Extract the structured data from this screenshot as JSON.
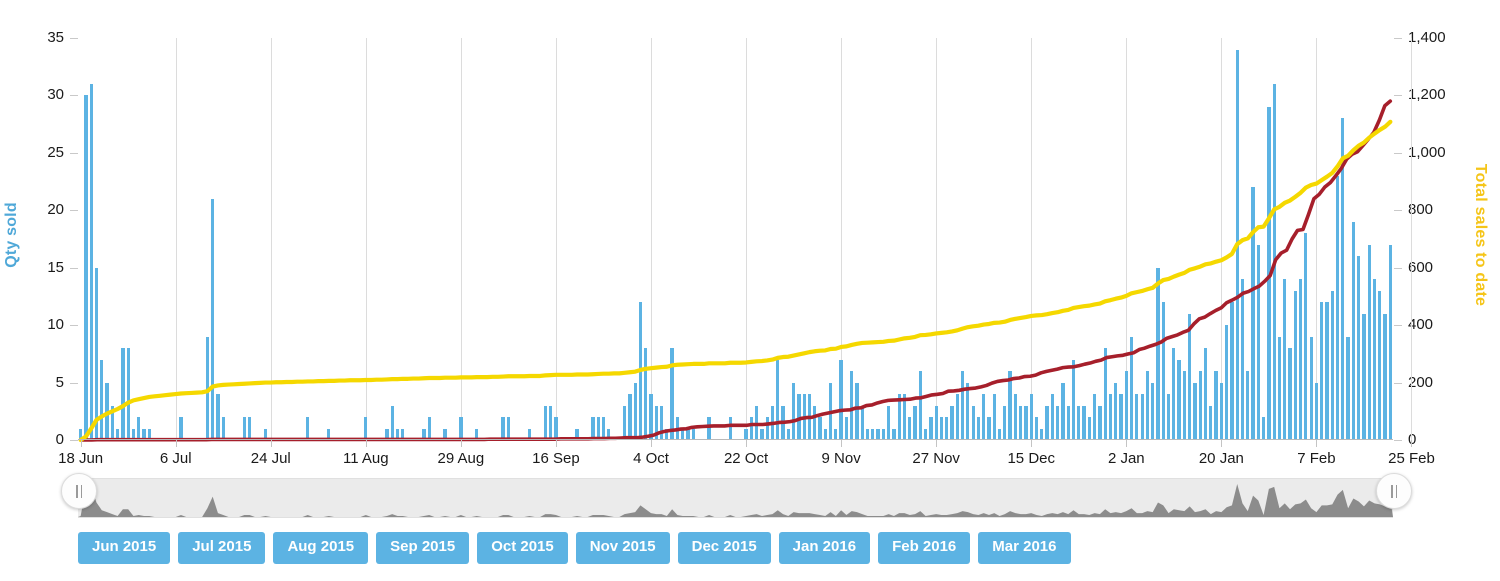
{
  "chart_data": {
    "type": "bar",
    "title": "",
    "xlabel": "",
    "ylabel": "Qty sold",
    "y2label": "Total sales to date",
    "ylim": [
      0,
      35
    ],
    "y2lim": [
      0,
      1400
    ],
    "grid": true,
    "legend_position": "none",
    "y_ticks": [
      "0",
      "5",
      "10",
      "15",
      "20",
      "25",
      "30",
      "35"
    ],
    "y2_ticks": [
      "0",
      "200",
      "400",
      "600",
      "800",
      "1,000",
      "1,200",
      "1,400"
    ],
    "x_tick_labels": [
      "18 Jun",
      "6 Jul",
      "24 Jul",
      "11 Aug",
      "29 Aug",
      "16 Sep",
      "4 Oct",
      "22 Oct",
      "9 Nov",
      "27 Nov",
      "15 Dec",
      "2 Jan",
      "20 Jan",
      "7 Feb",
      "25 Feb"
    ],
    "x_tick_indices": [
      0,
      18,
      36,
      54,
      72,
      90,
      108,
      126,
      144,
      162,
      180,
      198,
      216,
      234,
      252
    ],
    "colors": {
      "bar": "#5cb3e3",
      "qty_axis": "#4fa8d8",
      "total_sales_line": "#f5d800",
      "total_sales_axis": "#f5c518",
      "cumulative_line": "#a61f2b",
      "gridline": "#dcdcdc",
      "navigator_bg": "#ebebeb",
      "navigator_series": "#8c8c8c",
      "button": "#5cb3e3",
      "button_text": "#ffffff"
    },
    "series": [
      {
        "name": "Qty sold",
        "type": "bar",
        "axis": "left",
        "values": [
          1,
          30,
          31,
          15,
          7,
          5,
          3,
          1,
          8,
          8,
          1,
          2,
          1,
          1,
          0,
          0,
          0,
          0,
          0,
          2,
          0,
          0,
          0,
          0,
          9,
          21,
          4,
          2,
          0,
          0,
          0,
          2,
          2,
          0,
          0,
          1,
          0,
          0,
          0,
          0,
          0,
          0,
          0,
          2,
          0,
          0,
          0,
          1,
          0,
          0,
          0,
          0,
          0,
          0,
          2,
          0,
          0,
          0,
          1,
          3,
          1,
          1,
          0,
          0,
          0,
          1,
          2,
          0,
          0,
          1,
          0,
          0,
          2,
          0,
          0,
          1,
          0,
          0,
          0,
          0,
          2,
          2,
          0,
          0,
          0,
          1,
          0,
          0,
          3,
          3,
          2,
          0,
          0,
          0,
          1,
          0,
          0,
          2,
          2,
          2,
          1,
          0,
          0,
          3,
          4,
          5,
          12,
          8,
          4,
          3,
          3,
          1,
          8,
          2,
          1,
          1,
          1,
          0,
          0,
          2,
          0,
          0,
          0,
          2,
          0,
          0,
          1,
          2,
          3,
          1,
          2,
          3,
          7,
          3,
          1,
          5,
          4,
          4,
          4,
          3,
          2,
          1,
          5,
          1,
          7,
          2,
          6,
          5,
          3,
          1,
          1,
          1,
          1,
          3,
          1,
          4,
          4,
          2,
          3,
          6,
          1,
          2,
          3,
          2,
          2,
          3,
          4,
          6,
          5,
          3,
          2,
          4,
          2,
          4,
          1,
          3,
          6,
          4,
          3,
          3,
          4,
          2,
          1,
          3,
          4,
          3,
          5,
          3,
          7,
          3,
          3,
          2,
          4,
          3,
          8,
          4,
          5,
          4,
          6,
          9,
          4,
          4,
          6,
          5,
          15,
          12,
          4,
          8,
          7,
          6,
          11,
          5,
          6,
          8,
          3,
          6,
          5,
          10,
          12,
          34,
          14,
          6,
          22,
          17,
          2,
          29,
          31,
          9,
          14,
          8,
          13,
          14,
          18,
          9,
          5,
          12,
          12,
          13,
          23,
          28,
          9,
          19,
          16,
          11,
          17,
          14,
          13,
          11,
          17
        ],
        "max_value": 34,
        "notable_peaks": [
          {
            "x_label": "18 Jun",
            "value": 31
          },
          {
            "x_label": "mid Jul",
            "value": 21
          },
          {
            "x_label": "early Oct",
            "value": 12
          },
          {
            "x_label": "late Jan",
            "value": 34
          },
          {
            "x_label": "early Feb",
            "value": 31
          }
        ]
      },
      {
        "name": "Total sales to date",
        "type": "line",
        "axis": "right",
        "values": [
          0,
          12,
          40,
          70,
          82,
          92,
          100,
          108,
          118,
          130,
          138,
          142,
          146,
          150,
          152,
          154,
          156,
          158,
          160,
          162,
          163,
          164,
          165,
          166,
          170,
          186,
          190,
          192,
          193,
          194,
          195,
          196,
          197,
          198,
          199,
          200,
          200,
          201,
          201,
          202,
          202,
          203,
          203,
          204,
          204,
          205,
          205,
          206,
          206,
          207,
          207,
          208,
          208,
          208,
          209,
          209,
          210,
          210,
          211,
          212,
          212,
          213,
          213,
          214,
          214,
          215,
          216,
          216,
          216,
          217,
          217,
          217,
          218,
          218,
          218,
          219,
          219,
          219,
          220,
          220,
          221,
          222,
          222,
          222,
          222,
          223,
          223,
          223,
          225,
          226,
          227,
          227,
          227,
          227,
          228,
          228,
          228,
          229,
          230,
          231,
          231,
          232,
          232,
          234,
          236,
          238,
          244,
          248,
          250,
          252,
          254,
          255,
          260,
          262,
          263,
          264,
          265,
          265,
          265,
          267,
          267,
          267,
          267,
          269,
          269,
          269,
          270,
          272,
          274,
          275,
          277,
          280,
          286,
          289,
          290,
          294,
          298,
          302,
          306,
          309,
          311,
          312,
          317,
          318,
          324,
          326,
          331,
          335,
          338,
          339,
          340,
          341,
          342,
          345,
          346,
          350,
          354,
          356,
          359,
          365,
          366,
          368,
          371,
          373,
          375,
          378,
          382,
          388,
          393,
          396,
          398,
          402,
          404,
          408,
          409,
          412,
          418,
          422,
          425,
          428,
          432,
          434,
          435,
          438,
          442,
          445,
          450,
          453,
          460,
          463,
          466,
          468,
          472,
          475,
          483,
          487,
          492,
          496,
          502,
          511,
          515,
          519,
          525,
          530,
          545,
          557,
          561,
          569,
          576,
          582,
          593,
          598,
          604,
          612,
          615,
          621,
          626,
          636,
          648,
          682,
          696,
          702,
          724,
          741,
          743,
          772,
          803,
          812,
          826,
          834,
          847,
          861,
          879,
          888,
          893,
          905,
          917,
          930,
          953,
          981,
          990,
          1009,
          1025,
          1036,
          1053,
          1067,
          1080,
          1091,
          1108
        ],
        "end_value": 1225
      },
      {
        "name": "Cumulative",
        "type": "line",
        "axis": "right",
        "values": [
          0,
          0,
          0,
          1,
          1,
          1,
          1,
          1,
          1,
          1,
          1,
          1,
          1,
          1,
          1,
          1,
          1,
          1,
          1,
          1,
          1,
          1,
          1,
          1,
          2,
          2,
          2,
          2,
          2,
          2,
          2,
          2,
          2,
          2,
          2,
          2,
          2,
          2,
          2,
          2,
          2,
          2,
          2,
          2,
          2,
          2,
          2,
          2,
          2,
          2,
          2,
          2,
          2,
          2,
          2,
          2,
          2,
          2,
          2,
          2,
          2,
          2,
          2,
          2,
          2,
          2,
          2,
          2,
          2,
          2,
          2,
          2,
          2,
          2,
          2,
          3,
          3,
          3,
          3,
          3,
          3,
          3,
          3,
          3,
          3,
          3,
          3,
          3,
          4,
          4,
          4,
          4,
          4,
          4,
          5,
          5,
          5,
          6,
          6,
          7,
          8,
          8,
          8,
          10,
          13,
          17,
          25,
          30,
          33,
          35,
          38,
          39,
          44,
          46,
          47,
          48,
          49,
          49,
          49,
          51,
          51,
          51,
          51,
          54,
          54,
          54,
          56,
          58,
          61,
          62,
          64,
          68,
          75,
          78,
          79,
          85,
          90,
          94,
          98,
          102,
          104,
          105,
          111,
          112,
          120,
          122,
          129,
          134,
          138,
          139,
          140,
          141,
          142,
          146,
          147,
          152,
          157,
          159,
          162,
          170,
          171,
          173,
          177,
          179,
          181,
          185,
          190,
          198,
          204,
          207,
          209,
          214,
          216,
          221,
          222,
          226,
          234,
          239,
          243,
          247,
          252,
          254,
          255,
          259,
          264,
          268,
          274,
          278,
          287,
          290,
          293,
          295,
          300,
          304,
          315,
          320,
          327,
          333,
          341,
          354,
          360,
          366,
          375,
          382,
          404,
          422,
          428,
          440,
          451,
          460,
          478,
          487,
          497,
          511,
          517,
          527,
          536,
          553,
          573,
          628,
          651,
          661,
          700,
          730,
          733,
          785,
          840,
          856,
          881,
          896,
          920,
          945,
          978,
          995,
          1004,
          1026,
          1048,
          1072,
          1114,
          1164,
          1180
        ],
        "end_value": 1180
      }
    ]
  },
  "axes": {
    "left_title": "Qty sold",
    "right_title": "Total sales to date"
  },
  "navigator": {
    "name": "range-navigator",
    "left_handle_label": "||",
    "right_handle_label": "||"
  },
  "range_buttons": [
    {
      "label": "Jun 2015"
    },
    {
      "label": "Jul 2015"
    },
    {
      "label": "Aug 2015"
    },
    {
      "label": "Sep 2015"
    },
    {
      "label": "Oct 2015"
    },
    {
      "label": "Nov 2015"
    },
    {
      "label": "Dec 2015"
    },
    {
      "label": "Jan 2016"
    },
    {
      "label": "Feb 2016"
    },
    {
      "label": "Mar 2016"
    }
  ]
}
